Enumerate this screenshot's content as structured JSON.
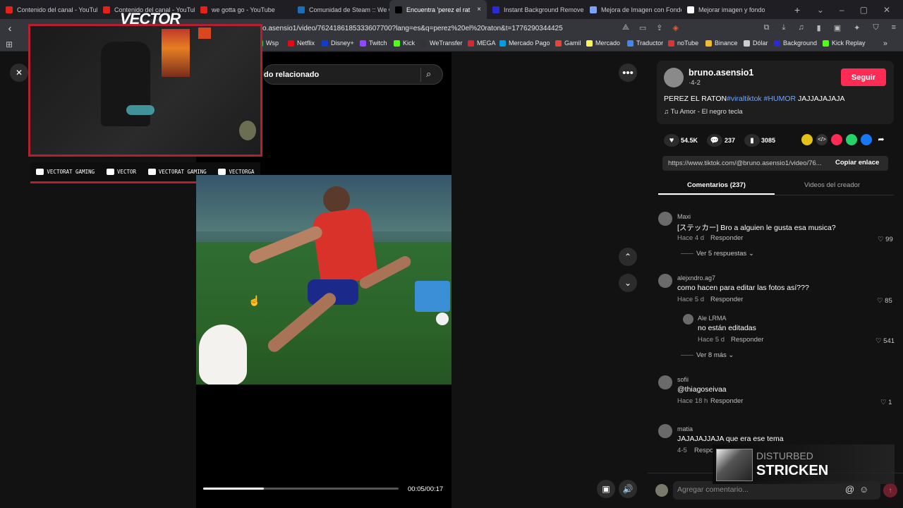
{
  "tabs": [
    {
      "title": "Contenido del canal - YouTube",
      "fav_color": "#e62117"
    },
    {
      "title": "Contenido del canal - YouTube",
      "fav_color": "#e62117"
    },
    {
      "title": "we gotta go - YouTube",
      "fav_color": "#e62117"
    },
    {
      "title": "Comunidad de Steam :: We G",
      "fav_color": "#1b6fb8"
    },
    {
      "title": "Encuentra 'perez el rat",
      "fav_color": "#000000",
      "active": true,
      "close": "×"
    },
    {
      "title": "Instant Background Remover",
      "fav_color": "#2b2bd6"
    },
    {
      "title": "Mejora de Imagen con Fondo",
      "fav_color": "#7aa3ff"
    },
    {
      "title": "Mejorar imagen y fondo",
      "fav_color": "#ffffff"
    }
  ],
  "tab_new": "+",
  "address": {
    "url": "o.asensio1/video/7624186185333607700?lang=es&q=perez%20el%20raton&t=1776290344425",
    "search_placeholder": "do relacionado"
  },
  "bookmarks": [
    {
      "label": "Wsp",
      "color": "#25d366"
    },
    {
      "label": "Netflix",
      "color": "#e50914"
    },
    {
      "label": "Disney+",
      "color": "#113ccf"
    },
    {
      "label": "Twitch",
      "color": "#9146ff"
    },
    {
      "label": "Kick",
      "color": "#53fc18"
    },
    {
      "label": "WeTransfer",
      "color": "#333333"
    },
    {
      "label": "MEGA",
      "color": "#d9272e"
    },
    {
      "label": "Mercado Pago",
      "color": "#009ee3"
    },
    {
      "label": "Gamil",
      "color": "#ea4335"
    },
    {
      "label": "Mercado",
      "color": "#fff159"
    },
    {
      "label": "Traductor",
      "color": "#4285f4"
    },
    {
      "label": "noTube",
      "color": "#d33"
    },
    {
      "label": "Binance",
      "color": "#f3ba2f"
    },
    {
      "label": "Dólar",
      "color": "#cccccc"
    },
    {
      "label": "Background",
      "color": "#2b2bd6"
    },
    {
      "label": "Kick Replay",
      "color": "#53fc18"
    }
  ],
  "overlay": {
    "brand": "VECTOR",
    "socials": [
      {
        "icon": "youtube-icon",
        "label": "VECTORAT GAMING"
      },
      {
        "icon": "twitch-icon",
        "label": "VECTOR"
      },
      {
        "icon": "twitter-icon",
        "label": "VECTORAT GAMING"
      },
      {
        "icon": "instagram-icon",
        "label": "VECTORGA"
      }
    ]
  },
  "video": {
    "time": "00:05/00:17",
    "progress": 0.31
  },
  "creator": {
    "username": "bruno.asensio1",
    "meta": "·4-2",
    "follow": "Seguir",
    "caption": "PEREZ EL RATON",
    "hashtags": [
      "#viraltiktok",
      "#HUMOR"
    ],
    "caption_end": " JAJJAJAJAJA",
    "music": "Tu Amor - El negro tecla",
    "likes": "54.5K",
    "comments": "237",
    "saves": "3085",
    "link": "https://www.tiktok.com/@bruno.asensio1/video/76...",
    "copy_link": "Copiar enlace"
  },
  "panel_tabs": {
    "comments": "Comentarios (237)",
    "creator_videos": "Videos del creador"
  },
  "comments": [
    {
      "user": "Maxi",
      "text": "[ステッカー] Bro a alguien le gusta esa musica?",
      "time": "Hace 4 d",
      "reply": "Responder",
      "likes": "99",
      "view_replies": "Ver 5 respuestas"
    },
    {
      "user": "alejxndro.ag7",
      "text": "como hacen para editar las fotos así???",
      "time": "Hace 5 d",
      "reply": "Responder",
      "likes": "85"
    },
    {
      "user": "Ale LRMA",
      "text": "no están editadas",
      "time": "Hace 5 d",
      "reply": "Responder",
      "likes": "541",
      "view_replies": "Ver 8 más"
    },
    {
      "user": "sofii",
      "text": "@thiagoseivaa",
      "time": "Hace 18 h",
      "reply": "Responder",
      "likes": "1"
    },
    {
      "user": "matia",
      "text": "JAJAJAJJAJA que era ese tema",
      "time": "4-5",
      "reply": "Respo"
    }
  ],
  "comment_input": {
    "placeholder": "Agregar comentario..."
  },
  "now_playing": {
    "artist": "DISTURBED",
    "song": "STRICKEN"
  }
}
